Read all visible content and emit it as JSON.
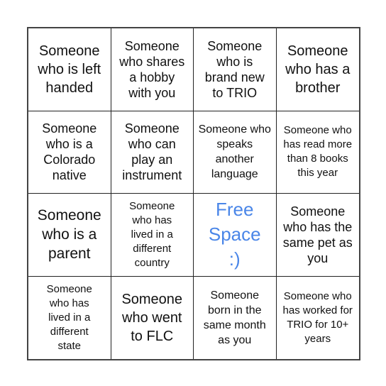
{
  "bingo": {
    "free_space_color": "#4a86e8",
    "cells": [
      {
        "text": "Someone who is left handed"
      },
      {
        "text": "Someone who shares a hobby with you"
      },
      {
        "text": "Someone who is brand new to TRIO"
      },
      {
        "text": "Someone who has a brother"
      },
      {
        "text": "Someone who is a Colorado native"
      },
      {
        "text": "Someone who can play an instrument"
      },
      {
        "text": "Someone who speaks another language"
      },
      {
        "text": "Someone who has read more than 8 books this year"
      },
      {
        "text": "Someone who is a parent"
      },
      {
        "text": "Someone who has lived in a different country"
      },
      {
        "text": "Free Space :)"
      },
      {
        "text": "Someone who has the same pet as you"
      },
      {
        "text": "Someone who has lived in a different state"
      },
      {
        "text": "Someone who went to FLC"
      },
      {
        "text": "Someone born in the same month as you"
      },
      {
        "text": "Someone who has worked for TRIO for 10+ years"
      }
    ]
  }
}
